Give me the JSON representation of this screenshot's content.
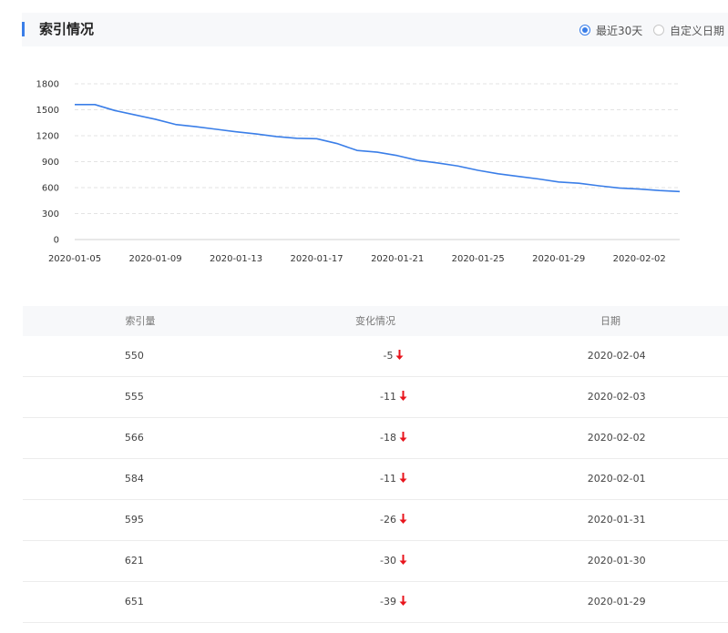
{
  "header": {
    "title": "索引情况",
    "options": [
      {
        "label": "最近30天",
        "checked": true
      },
      {
        "label": "自定义日期",
        "checked": false
      }
    ]
  },
  "colors": {
    "accent": "#3a7ee8",
    "down": "#e8141c"
  },
  "chart_data": {
    "type": "line",
    "ylim": [
      0,
      1800
    ],
    "yticks": [
      0,
      300,
      600,
      900,
      1200,
      1500,
      1800
    ],
    "x_tick_labels": [
      "2020-01-05",
      "2020-01-09",
      "2020-01-13",
      "2020-01-17",
      "2020-01-21",
      "2020-01-25",
      "2020-01-29",
      "2020-02-02"
    ],
    "x": [
      "2020-01-05",
      "2020-01-06",
      "2020-01-07",
      "2020-01-08",
      "2020-01-09",
      "2020-01-10",
      "2020-01-11",
      "2020-01-12",
      "2020-01-13",
      "2020-01-14",
      "2020-01-15",
      "2020-01-16",
      "2020-01-17",
      "2020-01-18",
      "2020-01-19",
      "2020-01-20",
      "2020-01-21",
      "2020-01-22",
      "2020-01-23",
      "2020-01-24",
      "2020-01-25",
      "2020-01-26",
      "2020-01-27",
      "2020-01-28",
      "2020-01-29",
      "2020-01-30",
      "2020-01-31",
      "2020-02-01",
      "2020-02-02",
      "2020-02-03",
      "2020-02-04"
    ],
    "series": [
      {
        "values": [
          1560,
          1560,
          1490,
          1440,
          1390,
          1330,
          1305,
          1275,
          1245,
          1220,
          1190,
          1170,
          1165,
          1110,
          1030,
          1010,
          970,
          915,
          885,
          850,
          800,
          760,
          730,
          700,
          665,
          651,
          621,
          595,
          584,
          566,
          555
        ]
      }
    ],
    "grid": true
  },
  "table": {
    "headers": [
      "索引量",
      "变化情况",
      "日期"
    ],
    "rows": [
      {
        "count": "550",
        "change": "-5",
        "date": "2020-02-04"
      },
      {
        "count": "555",
        "change": "-11",
        "date": "2020-02-03"
      },
      {
        "count": "566",
        "change": "-18",
        "date": "2020-02-02"
      },
      {
        "count": "584",
        "change": "-11",
        "date": "2020-02-01"
      },
      {
        "count": "595",
        "change": "-26",
        "date": "2020-01-31"
      },
      {
        "count": "621",
        "change": "-30",
        "date": "2020-01-30"
      },
      {
        "count": "651",
        "change": "-39",
        "date": "2020-01-29"
      }
    ]
  }
}
